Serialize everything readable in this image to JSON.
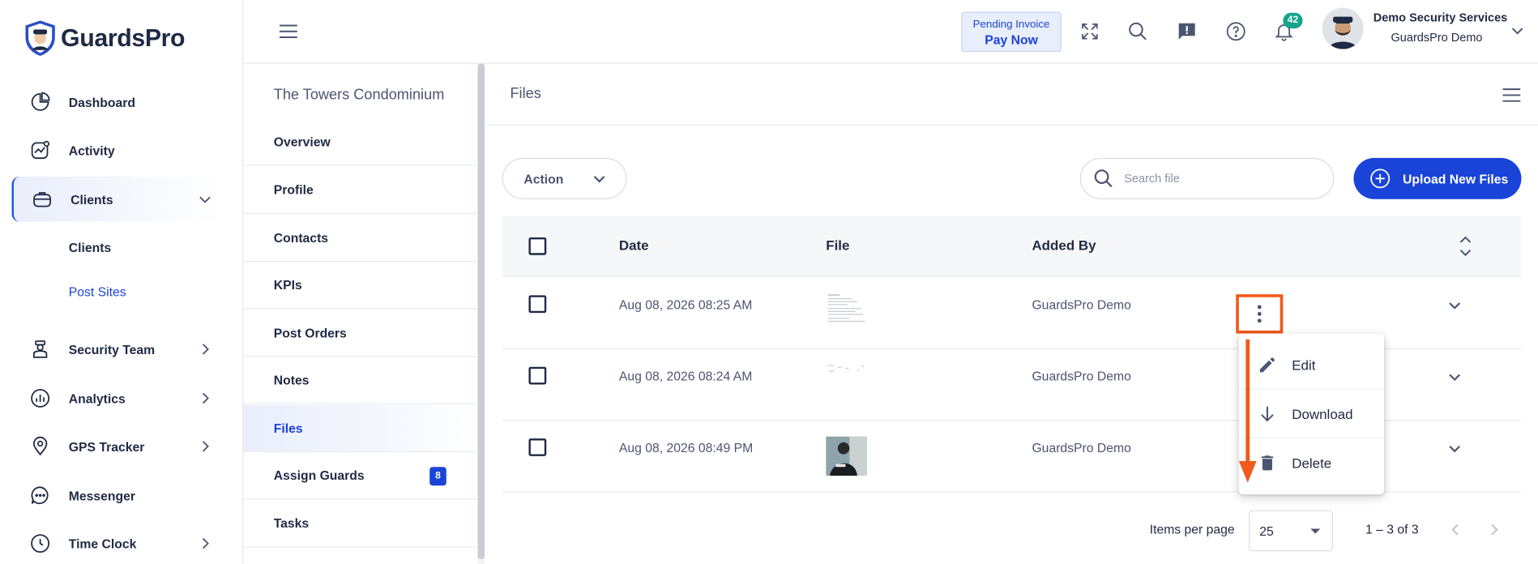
{
  "brand": {
    "name": "GuardsPro",
    "accent": "#1a44d8",
    "highlight": "#f05a1a"
  },
  "sidebar": {
    "items": [
      {
        "label": "Dashboard",
        "icon": "pie-chart-icon"
      },
      {
        "label": "Activity",
        "icon": "activity-chart-icon"
      },
      {
        "label": "Clients",
        "icon": "briefcase-icon"
      },
      {
        "label": "Security Team",
        "icon": "guard-icon"
      },
      {
        "label": "Analytics",
        "icon": "analytics-icon"
      },
      {
        "label": "GPS Tracker",
        "icon": "location-pin-icon"
      },
      {
        "label": "Messenger",
        "icon": "chat-bubble-icon"
      },
      {
        "label": "Time Clock",
        "icon": "clock-icon"
      }
    ],
    "clients_sub": [
      {
        "label": "Clients"
      },
      {
        "label": "Post Sites"
      }
    ]
  },
  "topbar": {
    "pending_invoice": "Pending Invoice",
    "pay_now": "Pay Now",
    "notification_count": "42",
    "user_name": "Demo Security Services",
    "user_org": "GuardsPro Demo"
  },
  "site": {
    "title": "The Towers Condominium",
    "menu": [
      {
        "label": "Overview"
      },
      {
        "label": "Profile"
      },
      {
        "label": "Contacts"
      },
      {
        "label": "KPIs"
      },
      {
        "label": "Post Orders"
      },
      {
        "label": "Notes"
      },
      {
        "label": "Files"
      },
      {
        "label": "Assign Guards",
        "count": "8"
      },
      {
        "label": "Tasks"
      }
    ]
  },
  "files": {
    "title": "Files",
    "action_label": "Action",
    "search_placeholder": "Search file",
    "upload_label": "Upload New Files",
    "columns": {
      "date": "Date",
      "file": "File",
      "added_by": "Added By"
    },
    "rows": [
      {
        "date": "Aug 08, 2026 08:25 AM",
        "added_by": "GuardsPro Demo"
      },
      {
        "date": "Aug 08, 2026 08:24 AM",
        "added_by": "GuardsPro Demo"
      },
      {
        "date": "Aug 08, 2026 08:49 PM",
        "added_by": "GuardsPro Demo"
      }
    ],
    "menu": {
      "edit": "Edit",
      "download": "Download",
      "delete": "Delete"
    },
    "pager": {
      "items_per_page": "Items per page",
      "per_page_value": "25",
      "range": "1 – 3 of 3"
    }
  }
}
